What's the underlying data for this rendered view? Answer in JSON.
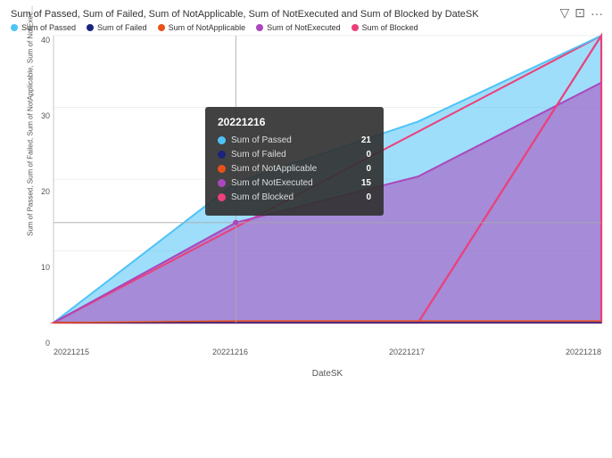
{
  "title": "Sum of Passed, Sum of Failed, Sum of NotApplicable, Sum of NotExecuted and Sum of Blocked by DateSK",
  "toolbar": {
    "filter_icon": "▽",
    "expand_icon": "⛶",
    "more_icon": "···"
  },
  "legend": [
    {
      "label": "Sum of Passed",
      "color": "#4FC3F7"
    },
    {
      "label": "Sum of Failed",
      "color": "#1A237E"
    },
    {
      "label": "Sum of NotApplicable",
      "color": "#E8521A"
    },
    {
      "label": "Sum of NotExecuted",
      "color": "#AB47BC"
    },
    {
      "label": "Sum of Blocked",
      "color": "#EC407A"
    }
  ],
  "y_axis_label": "Sum of Passed, Sum of Failed, Sum of NotApplicable, Sum of NotExec...",
  "x_axis_label": "DateSK",
  "x_ticks": [
    "20221215",
    "20221216",
    "20221217",
    "20221218"
  ],
  "y_ticks": [
    "0",
    "10",
    "20",
    "30",
    "40"
  ],
  "tooltip": {
    "date": "20221216",
    "rows": [
      {
        "label": "Sum of Passed",
        "color": "#4FC3F7",
        "value": "21"
      },
      {
        "label": "Sum of Failed",
        "color": "#1A237E",
        "value": "0"
      },
      {
        "label": "Sum of NotApplicable",
        "color": "#E8521A",
        "value": "0"
      },
      {
        "label": "Sum of NotExecuted",
        "color": "#AB47BC",
        "value": "15"
      },
      {
        "label": "Sum of Blocked",
        "color": "#EC407A",
        "value": "0"
      }
    ]
  },
  "chart": {
    "dates": [
      "20221215",
      "20221216",
      "20221217",
      "20221218"
    ],
    "passed": [
      0,
      21,
      30,
      43
    ],
    "failed": [
      0,
      0,
      0,
      0
    ],
    "not_applicable": [
      0,
      0,
      0,
      0
    ],
    "not_executed": [
      0,
      15,
      22,
      36
    ],
    "blocked": [
      0,
      0,
      0,
      43
    ]
  }
}
